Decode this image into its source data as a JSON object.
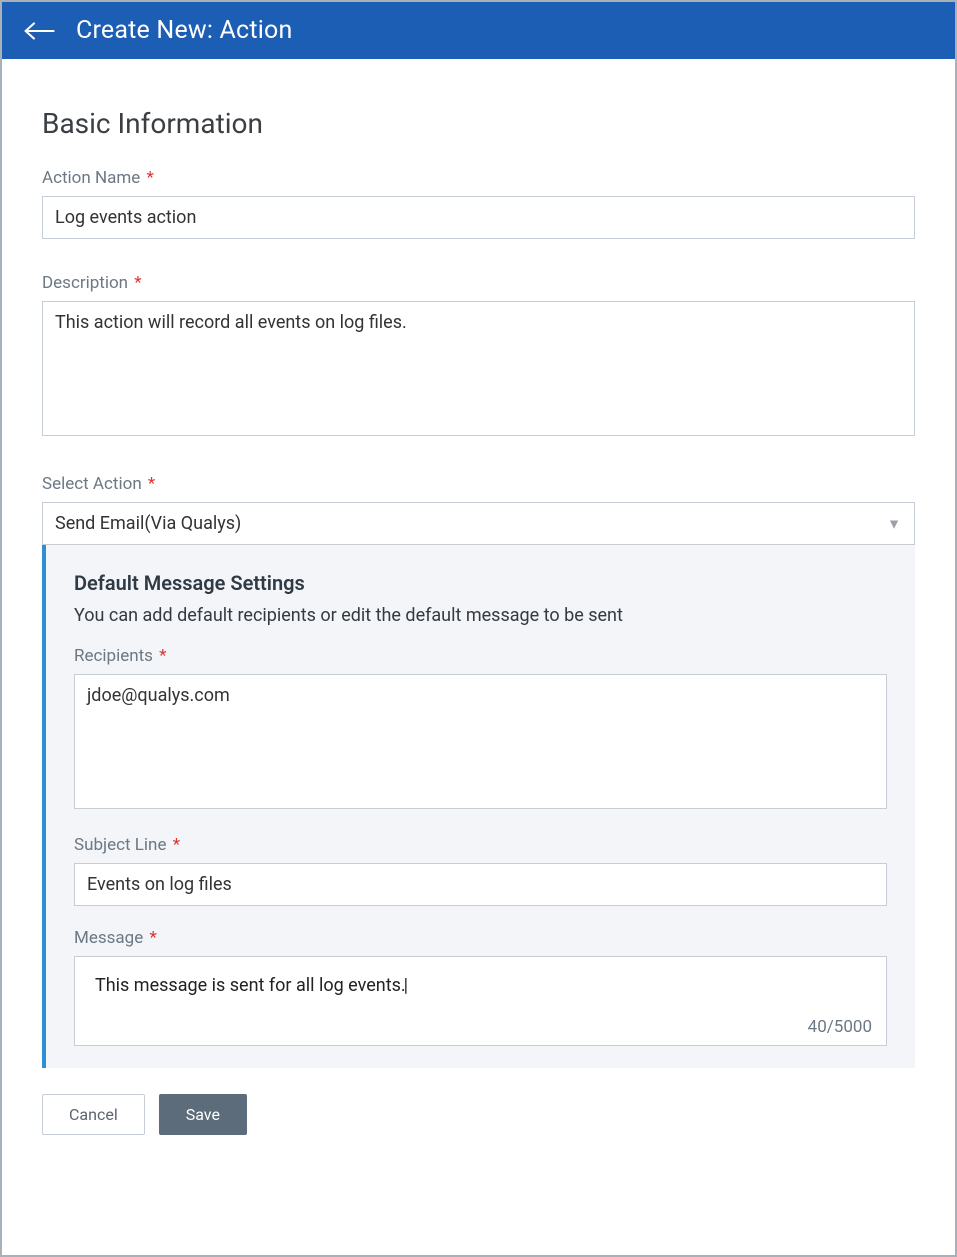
{
  "header": {
    "title": "Create New: Action"
  },
  "section": {
    "title": "Basic Information"
  },
  "fields": {
    "action_name": {
      "label": "Action Name",
      "value": "Log events action"
    },
    "description": {
      "label": "Description",
      "value": "This action will record all events on log files."
    },
    "select_action": {
      "label": "Select Action",
      "value": "Send Email(Via Qualys)"
    }
  },
  "panel": {
    "title": "Default Message Settings",
    "subtitle": "You can add default recipients or edit the default message to be sent",
    "recipients": {
      "label": "Recipients",
      "value": "jdoe@qualys.com"
    },
    "subject": {
      "label": "Subject Line",
      "value": "Events on log files"
    },
    "message": {
      "label": "Message",
      "value": "This message is sent for all log events.",
      "char_count": "40/5000"
    }
  },
  "buttons": {
    "cancel": "Cancel",
    "save": "Save"
  }
}
